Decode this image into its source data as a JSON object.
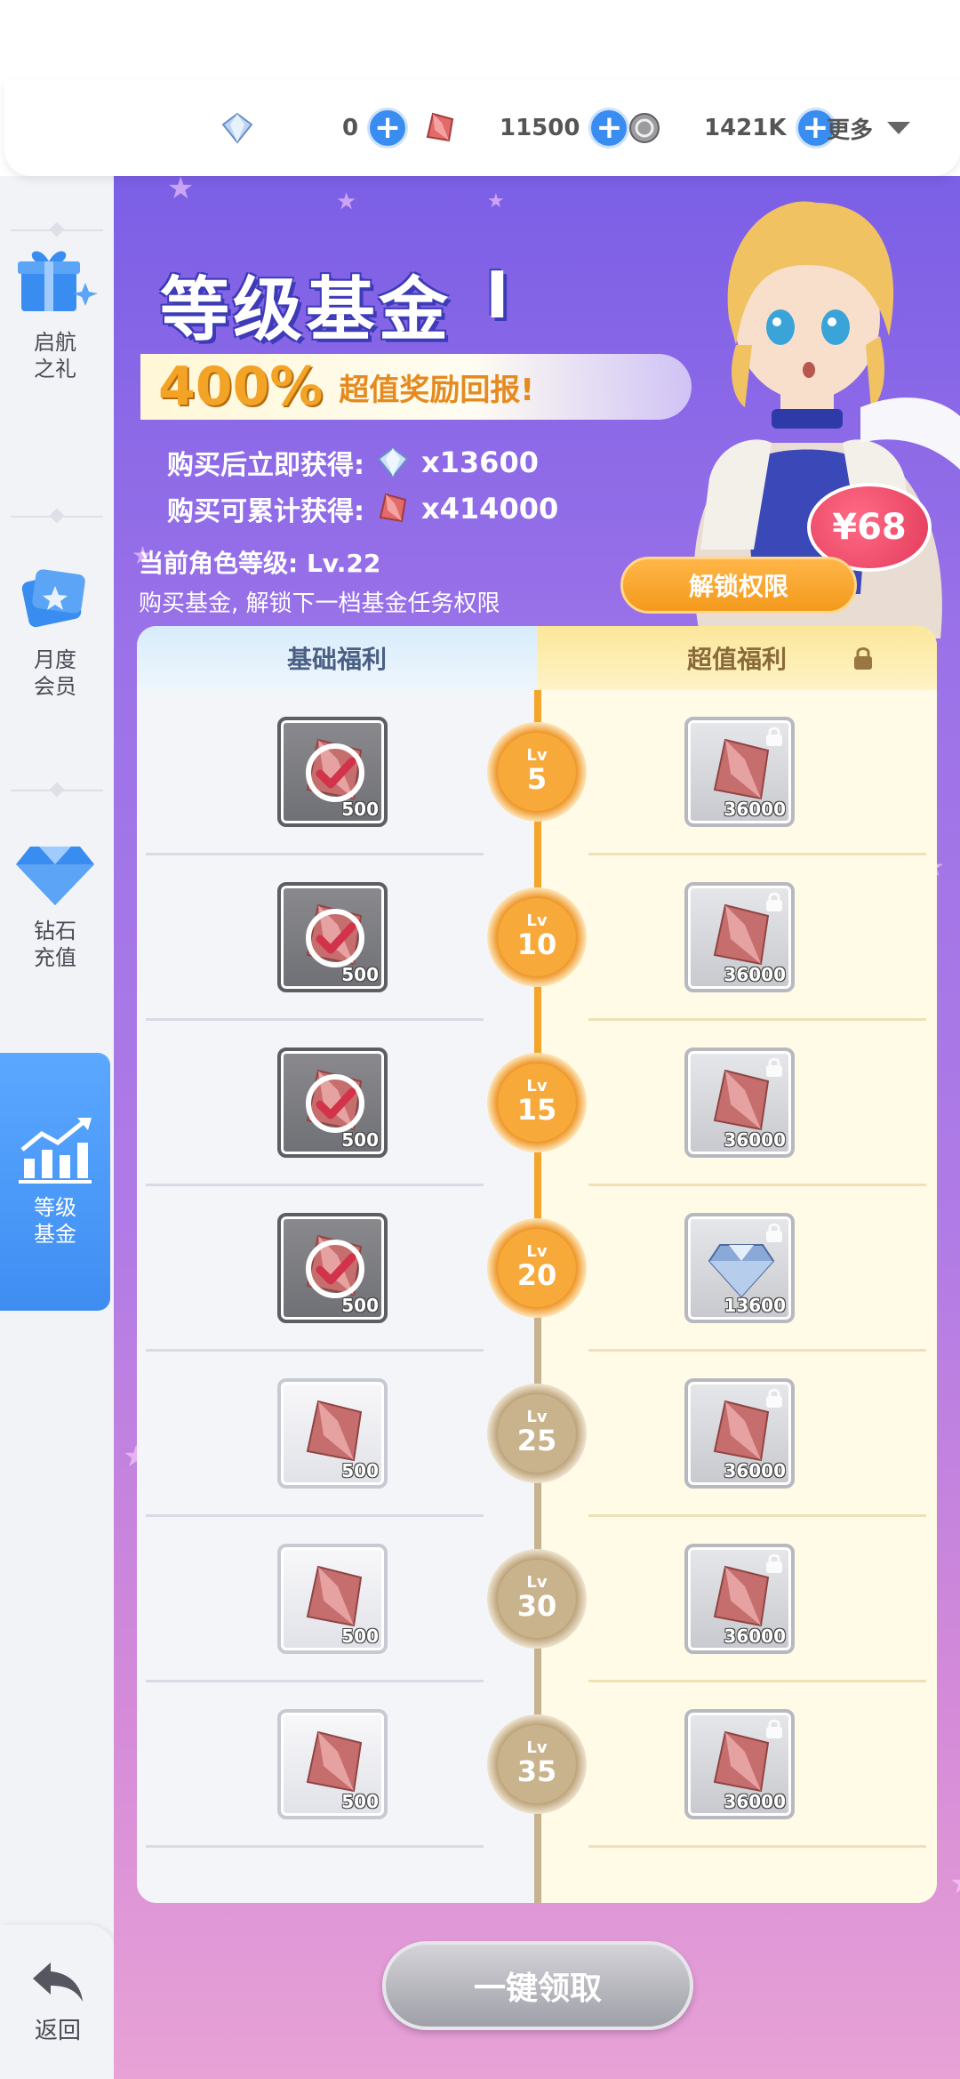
{
  "currencies": [
    {
      "icon": "diamond-icon",
      "value": "0"
    },
    {
      "icon": "red-crystal-icon",
      "value": "11500"
    },
    {
      "icon": "coin-icon",
      "value": "1421K"
    }
  ],
  "more_label": "更多",
  "sidebar": {
    "items": [
      {
        "label": "启航之礼",
        "icon": "gift-icon"
      },
      {
        "label": "月度会员",
        "icon": "card-icon"
      },
      {
        "label": "钻石充值",
        "icon": "diamond-icon"
      },
      {
        "label": "等级基金",
        "icon": "growth-chart-icon"
      }
    ],
    "back_label": "返回"
  },
  "banner": {
    "title": "等级基金",
    "roman": "Ⅰ",
    "percent": "400%",
    "percent_sub": "超值奖励回报!",
    "gain_now_label": "购买后立即获得:",
    "gain_now_amount": "x13600",
    "gain_total_label": "购买可累计获得:",
    "gain_total_amount": "x414000",
    "level_text": "当前角色等级: Lv.22",
    "hint_text": "购买基金, 解锁下一档基金任务权限",
    "price": "¥68",
    "unlock_label": "解锁权限"
  },
  "table": {
    "basic_header": "基础福利",
    "premium_header": "超值福利",
    "rows": [
      {
        "lv": "5",
        "basic_qty": "500",
        "premium_qty": "36000",
        "reached": true
      },
      {
        "lv": "10",
        "basic_qty": "500",
        "premium_qty": "36000",
        "reached": true
      },
      {
        "lv": "15",
        "basic_qty": "500",
        "premium_qty": "36000",
        "reached": true
      },
      {
        "lv": "20",
        "basic_qty": "500",
        "premium_qty": "13600",
        "reached": true
      },
      {
        "lv": "25",
        "basic_qty": "500",
        "premium_qty": "36000",
        "reached": false
      },
      {
        "lv": "30",
        "basic_qty": "500",
        "premium_qty": "36000",
        "reached": false
      },
      {
        "lv": "35",
        "basic_qty": "500",
        "premium_qty": "36000",
        "reached": false
      }
    ],
    "lv_label": "Lv"
  },
  "claim_all_label": "一键领取"
}
